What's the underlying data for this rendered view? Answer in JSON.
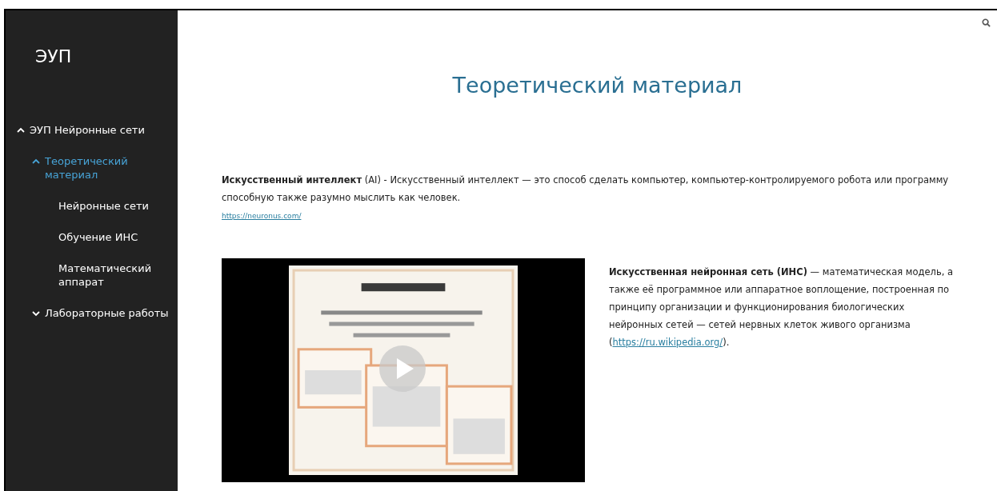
{
  "sidebar": {
    "title": "ЭУП",
    "items": [
      {
        "label": "ЭУП Нейронные сети",
        "selected": false,
        "expanded": true,
        "children": [
          {
            "label": "Теоретический материал",
            "selected": true,
            "expanded": true,
            "children": [
              {
                "label": "Нейронные сети",
                "selected": false
              },
              {
                "label": "Обучение ИНС",
                "selected": false
              },
              {
                "label": "Математический аппарат",
                "selected": false
              }
            ]
          },
          {
            "label": "Лабораторные работы",
            "selected": false,
            "expanded": false
          }
        ]
      }
    ]
  },
  "page": {
    "title": "Теоретический материал",
    "intro": {
      "text": "**Искусственный интеллект** (AI) - Искусственный интеллект — это способ сделать компьютер, компьютер-контролируемого робота или программу способную также разумно мыслить как человек.",
      "link": "https://neuronus.com/"
    },
    "definition": {
      "text": "**Искусственная нейронная сеть (ИНС)** — математическая модель, а также её программное или аппаратное воплощение, построенная по принципу организации и функционирования биологических нейронных сетей — сетей нервных клеток живого организма",
      "open": "(",
      "link": "https://ru.wikipedia.org/",
      "close": ")."
    }
  }
}
